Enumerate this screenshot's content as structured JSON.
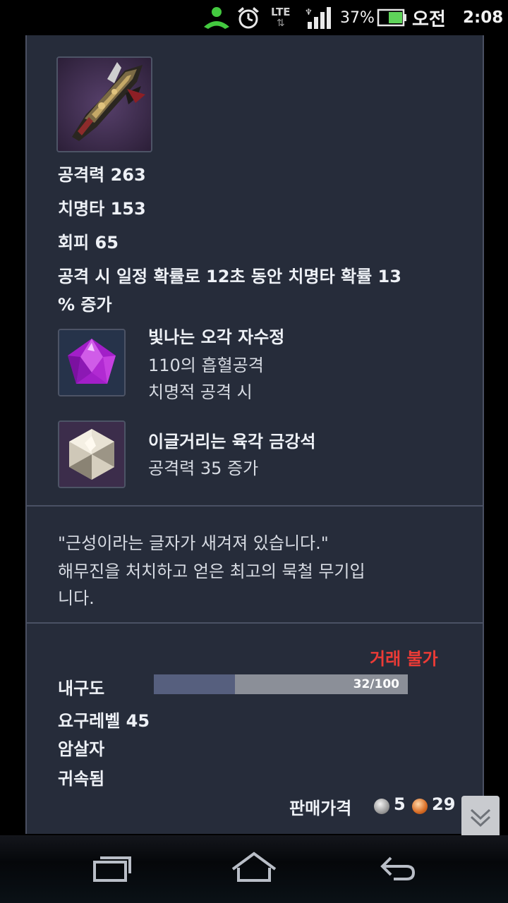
{
  "status_bar": {
    "network": "LTE",
    "battery_percent": "37%",
    "ampm": "오전",
    "time": "2:08",
    "icons": [
      "phone-call-icon",
      "alarm-clock-icon",
      "lte-data-icon",
      "signal-icon",
      "battery-icon"
    ]
  },
  "item": {
    "icon": "weapon-gauntlet-icon",
    "stats": [
      "공격력 263",
      "치명타 153",
      "회피 65"
    ],
    "effect_line1": "공격 시 일정 확률로 12초 동안 치명타 확률 13",
    "effect_line2": "% 증가",
    "gems": [
      {
        "icon": "purple-pentagon-gem-icon",
        "name": "빛나는 오각 자수정",
        "lines": [
          "110의 흡혈공격",
          "치명적 공격 시"
        ]
      },
      {
        "icon": "hexagon-diamond-gem-icon",
        "name": "이글거리는 육각 금강석",
        "lines": [
          "공격력 35 증가"
        ]
      }
    ],
    "description_line1": "\"근성이라는 글자가 새겨져 있습니다.\"",
    "description_line2": "해무진을 처치하고 얻은 최고의 묵철 무기입",
    "description_line3": "니다.",
    "trade_status": "거래 불가",
    "durability_label": "내구도",
    "durability_text": "32/100",
    "durability_fraction": 0.32,
    "required_level": "요구레벨 45",
    "class": "암살자",
    "binding": "귀속됨",
    "sell_price_label": "판매가격",
    "sell_price_silver": "5",
    "sell_price_copper": "29"
  },
  "navigation": {
    "recent_apps": "recent-apps-icon",
    "home": "home-icon",
    "back": "back-icon",
    "scroll_down": "double-chevron-down-icon"
  },
  "colors": {
    "panel_bg": "#262c3a",
    "untradeable": "#ec3b36",
    "durability_fill": "#565f7e",
    "durability_track": "#8b8f98"
  }
}
